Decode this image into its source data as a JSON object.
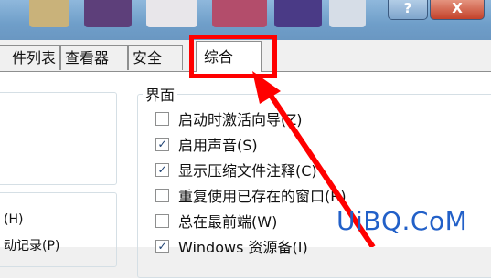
{
  "title_bar": {
    "help_label": "?",
    "close_label": "X"
  },
  "tabs": [
    {
      "label": "件列表"
    },
    {
      "label": "查看器"
    },
    {
      "label": "安全"
    },
    {
      "label": "综合",
      "selected": true
    }
  ],
  "interface_group": {
    "title": "界面",
    "options": [
      {
        "label": "启动时激活向导(Z)",
        "checked": false
      },
      {
        "label": "启用声音(S)",
        "checked": true
      },
      {
        "label": "显示压缩文件注释(C)",
        "checked": true
      },
      {
        "label": "重复使用已存在的窗口(R)",
        "checked": false
      },
      {
        "label": "总在最前端(W)",
        "checked": false
      },
      {
        "label": "Windows 资源备(I)",
        "checked": true
      }
    ]
  },
  "left_panel": {
    "text1": "(H)",
    "text2": "动记录(P)"
  },
  "watermark": "UiBQ.CoM",
  "colors": {
    "highlight": "#ff0000",
    "arrow": "#ff0000",
    "watermark": "#2260c8"
  }
}
